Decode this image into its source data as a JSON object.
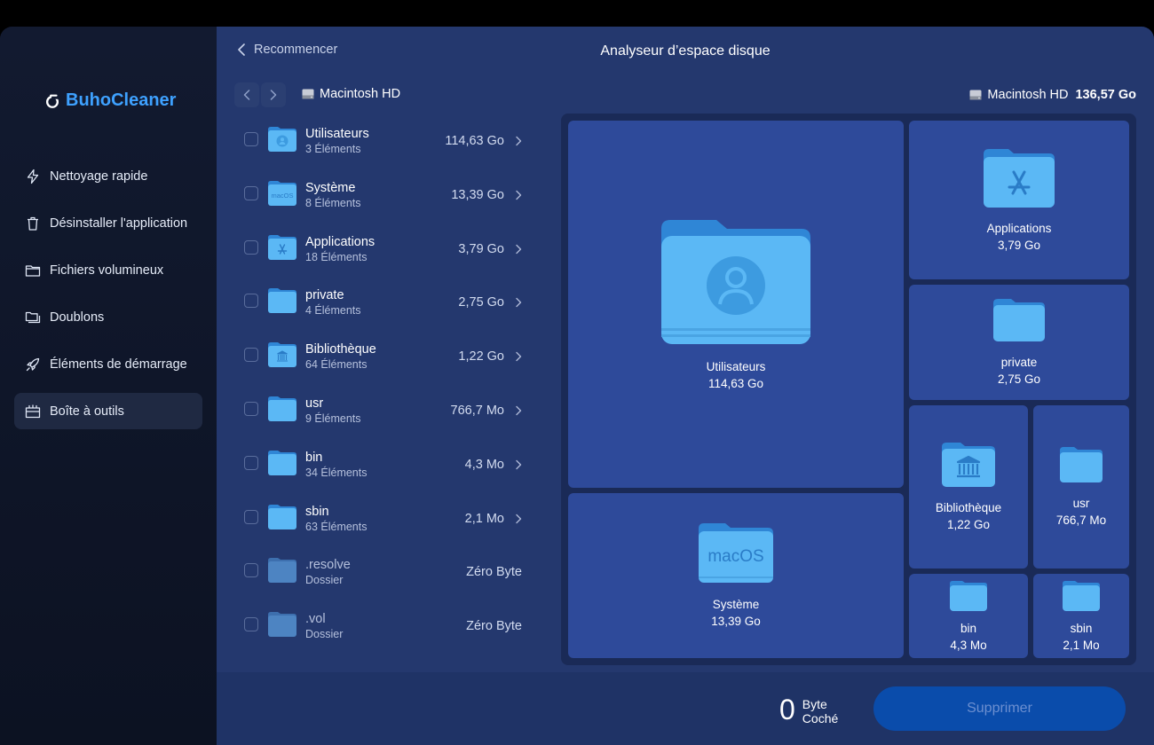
{
  "app": {
    "name": "BuhoCleaner",
    "brand_color": "#3ea1ff"
  },
  "sidebar": {
    "items": [
      {
        "label": "Nettoyage rapide",
        "icon": "bolt-icon",
        "active": false
      },
      {
        "label": "Désinstaller l'application",
        "icon": "trash-icon",
        "active": false
      },
      {
        "label": "Fichiers volumineux",
        "icon": "folder-icon",
        "active": false
      },
      {
        "label": "Doublons",
        "icon": "duplicate-folders-icon",
        "active": false
      },
      {
        "label": "Éléments de démarrage",
        "icon": "rocket-icon",
        "active": false
      },
      {
        "label": "Boîte à outils",
        "icon": "toolbox-icon",
        "active": true
      }
    ]
  },
  "header": {
    "restart_label": "Recommencer",
    "title": "Analyseur d’espace disque"
  },
  "breadcrumb": {
    "disk": "Macintosh HD"
  },
  "disk_summary": {
    "name": "Macintosh HD",
    "size": "136,57 Go"
  },
  "files": [
    {
      "name": "Utilisateurs",
      "sub": "3 Éléments",
      "size": "114,63 Go",
      "icon": "users-folder-icon",
      "expandable": true
    },
    {
      "name": "Système",
      "sub": "8 Éléments",
      "size": "13,39 Go",
      "icon": "macos-folder-icon",
      "expandable": true
    },
    {
      "name": "Applications",
      "sub": "18 Éléments",
      "size": "3,79 Go",
      "icon": "applications-folder-icon",
      "expandable": true
    },
    {
      "name": "private",
      "sub": "4 Éléments",
      "size": "2,75 Go",
      "icon": "folder-icon",
      "expandable": true
    },
    {
      "name": "Bibliothèque",
      "sub": "64 Éléments",
      "size": "1,22 Go",
      "icon": "library-folder-icon",
      "expandable": true
    },
    {
      "name": "usr",
      "sub": "9 Éléments",
      "size": "766,7 Mo",
      "icon": "folder-icon",
      "expandable": true
    },
    {
      "name": "bin",
      "sub": "34 Éléments",
      "size": "4,3 Mo",
      "icon": "folder-icon",
      "expandable": true
    },
    {
      "name": "sbin",
      "sub": "63 Éléments",
      "size": "2,1 Mo",
      "icon": "folder-icon",
      "expandable": true
    },
    {
      "name": ".resolve",
      "sub": "Dossier",
      "size": "Zéro Byte",
      "icon": "folder-icon",
      "expandable": false
    },
    {
      "name": ".vol",
      "sub": "Dossier",
      "size": "Zéro Byte",
      "icon": "folder-icon",
      "expandable": false
    }
  ],
  "treemap": {
    "tiles": [
      {
        "name": "Utilisateurs",
        "size": "114,63 Go"
      },
      {
        "name": "Système",
        "size": "13,39 Go",
        "badge": "macOS"
      },
      {
        "name": "Applications",
        "size": "3,79 Go"
      },
      {
        "name": "private",
        "size": "2,75 Go"
      },
      {
        "name": "Bibliothèque",
        "size": "1,22 Go"
      },
      {
        "name": "usr",
        "size": "766,7 Mo"
      },
      {
        "name": "bin",
        "size": "4,3 Mo"
      },
      {
        "name": "sbin",
        "size": "2,1 Mo"
      }
    ]
  },
  "footer": {
    "count_value": "0",
    "count_unit": "Byte",
    "count_label": "Coché",
    "delete_label": "Supprimer"
  },
  "colors": {
    "sidebar_bg": "#121a30",
    "main_bg": "#24386e",
    "tile_bg": "#2e4a9a",
    "folder_blue": "#5bb8f5",
    "button_bg": "#0a4cab"
  }
}
